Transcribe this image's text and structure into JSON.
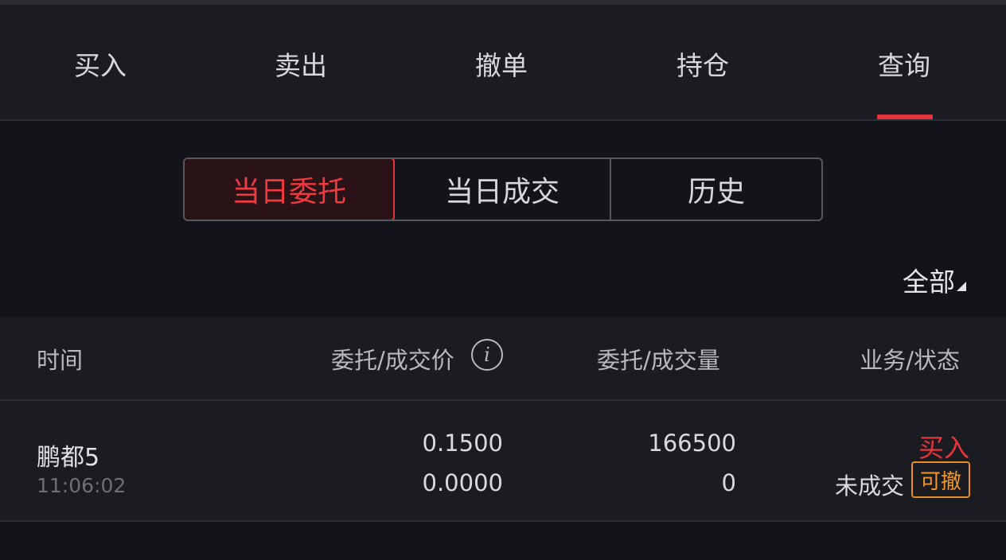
{
  "nav": {
    "tabs": [
      {
        "label": "买入"
      },
      {
        "label": "卖出"
      },
      {
        "label": "撤单"
      },
      {
        "label": "持仓"
      },
      {
        "label": "查询"
      }
    ],
    "active_index": 4
  },
  "segment": {
    "items": [
      {
        "label": "当日委托"
      },
      {
        "label": "当日成交"
      },
      {
        "label": "历史"
      }
    ],
    "active_index": 0
  },
  "filter": {
    "label": "全部"
  },
  "table": {
    "headers": {
      "time": "时间",
      "price": "委托/成交价",
      "qty": "委托/成交量",
      "status": "业务/状态"
    },
    "rows": [
      {
        "name": "鹏都5",
        "time": "11:06:02",
        "order_price": "0.1500",
        "deal_price": "0.0000",
        "order_qty": "166500",
        "deal_qty": "0",
        "side": "买入",
        "status": "未成交",
        "action": "可撤"
      }
    ]
  },
  "colors": {
    "background": "#121419",
    "panel": "#1a1c22",
    "accent_red": "#e5353b",
    "accent_orange": "#f0962a"
  },
  "icons": {
    "info": "info-circle-icon",
    "filter_caret": "caret-down-right-icon"
  }
}
